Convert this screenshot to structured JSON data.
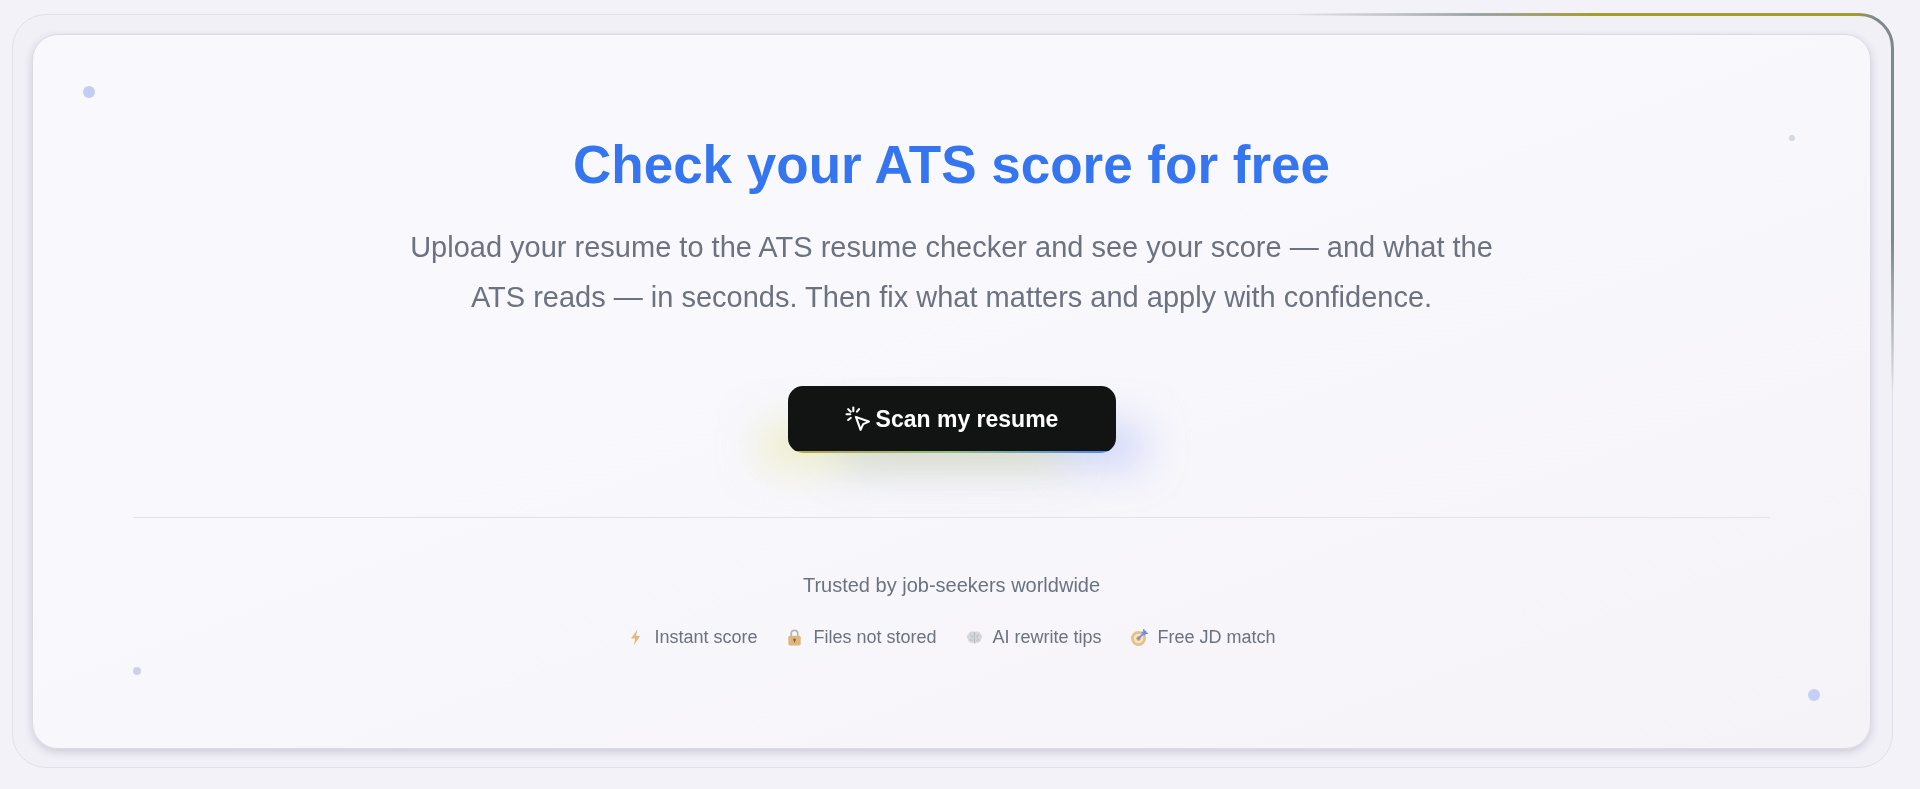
{
  "hero": {
    "title": "Check your ATS score for free",
    "subtitle": "Upload your resume to the ATS resume checker and see your score — and what the ATS reads — in seconds. Then fix what matters and apply with confidence.",
    "button": {
      "label": "Scan my resume"
    }
  },
  "trust": {
    "caption": "Trusted by job-seekers worldwide",
    "features": [
      {
        "kind": "bolt",
        "label": "Instant score"
      },
      {
        "kind": "lock",
        "label": "Files not stored"
      },
      {
        "kind": "brain",
        "label": "AI rewrite tips"
      },
      {
        "kind": "target",
        "label": "Free JD match"
      }
    ]
  }
}
